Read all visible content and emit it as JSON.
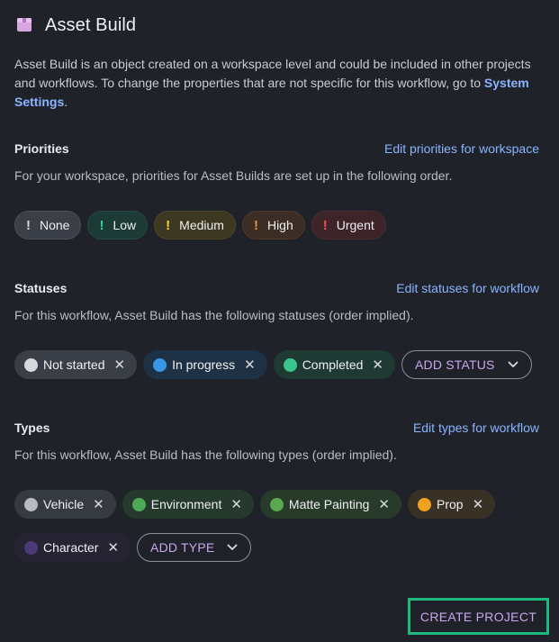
{
  "header": {
    "title": "Asset Build",
    "icon": "package-box-icon"
  },
  "description": {
    "text": "Asset Build is an object created on a workspace level and could be included in other projects and workflows. To change the properties that are not specific for this workflow, go to ",
    "link": "System Settings",
    "suffix": "."
  },
  "priorities": {
    "title": "Priorities",
    "link": "Edit priorities for workspace",
    "subtitle": "For your workspace, priorities for Asset Builds are set up in the following order.",
    "items": [
      {
        "label": "None",
        "color": "#d9dbe0",
        "bg": "#3b3f47",
        "border": "#4a4f58"
      },
      {
        "label": "Low",
        "color": "#2fd69a",
        "bg": "#1d3b36",
        "border": "#25483f"
      },
      {
        "label": "Medium",
        "color": "#f2d43a",
        "bg": "#3c3822",
        "border": "#4b4528"
      },
      {
        "label": "High",
        "color": "#f3913a",
        "bg": "#3d2e25",
        "border": "#4c3829"
      },
      {
        "label": "Urgent",
        "color": "#f05252",
        "bg": "#3d2428",
        "border": "#4d2b30"
      }
    ]
  },
  "statuses": {
    "title": "Statuses",
    "link": "Edit statuses for workflow",
    "subtitle": "For this workflow, Asset Build has the following statuses (order implied).",
    "items": [
      {
        "label": "Not started",
        "color": "#d6d8dc",
        "bg": "#3a3e46"
      },
      {
        "label": "In progress",
        "color": "#3a97e6",
        "bg": "#1f3245"
      },
      {
        "label": "Completed",
        "color": "#3cc48f",
        "bg": "#1e3a32"
      }
    ],
    "add_label": "ADD STATUS"
  },
  "types": {
    "title": "Types",
    "link": "Edit types for workflow",
    "subtitle": "For this workflow, Asset Build has the following types (order implied).",
    "items": [
      {
        "label": "Vehicle",
        "color": "#b8bbc1",
        "bg": "#363a41"
      },
      {
        "label": "Environment",
        "color": "#4faa58",
        "bg": "#253a2c"
      },
      {
        "label": "Matte Painting",
        "color": "#5aa852",
        "bg": "#283b2b"
      },
      {
        "label": "Prop",
        "color": "#f0a21e",
        "bg": "#3a3126"
      },
      {
        "label": "Character",
        "color": "#4a3a7a",
        "bg": "#262432"
      }
    ],
    "add_label": "ADD TYPE"
  },
  "footer": {
    "create_label": "CREATE PROJECT",
    "create_border": "#1db97d"
  }
}
